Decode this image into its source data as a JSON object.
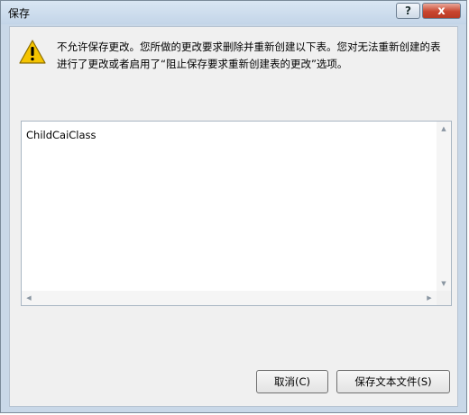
{
  "window": {
    "title": "保存",
    "help_label": "?",
    "close_label": "x"
  },
  "dialog": {
    "message_line1": "不允许保存更改。您所做的更改要求删除并重新创建以下表。您对无法重新创建的表",
    "message_line2": "进行了更改或者启用了“阻止保存要求重新创建表的更改”选项。",
    "icon": "warning-icon",
    "list_items": [
      "ChildCaiClass"
    ]
  },
  "buttons": {
    "cancel_label": "取消(C)",
    "save_text_label": "保存文本文件(S)"
  },
  "colors": {
    "title_bar": "#c9d8e8",
    "close_button": "#c9452e",
    "dialog_body": "#f0f0f0",
    "warning_yellow": "#f5c400"
  }
}
